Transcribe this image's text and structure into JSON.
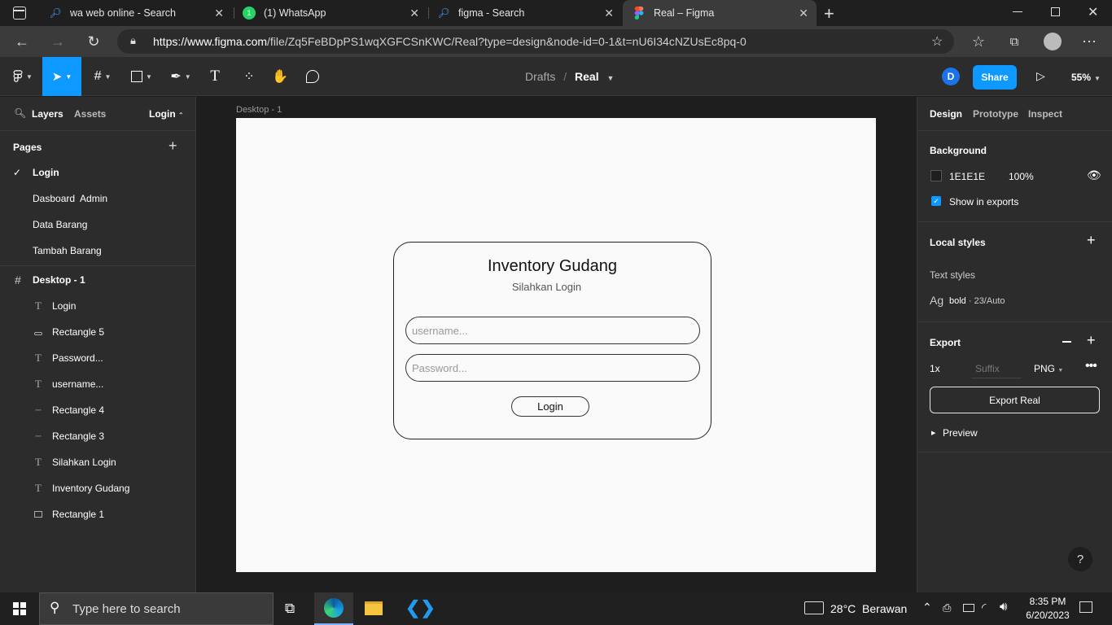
{
  "browser": {
    "tabs": [
      {
        "title": "wa web online - Search"
      },
      {
        "title": "(1) WhatsApp",
        "badge": "1"
      },
      {
        "title": "figma - Search"
      },
      {
        "title": "Real – Figma"
      }
    ],
    "url": "https://www.figma.com/file/Zq5FeBDpPS1wqXGFCSnKWC/Real?type=design&node-id=0-1&t=nU6I34cNZUsEc8pq-0",
    "url_host": "https://www.figma.com",
    "url_rest": "/file/Zq5FeBDpPS1wqXGFCSnKWC/Real?type=design&node-id=0-1&t=nU6I34cNZUsEc8pq-0"
  },
  "figma_toolbar": {
    "breadcrumb_drafts": "Drafts",
    "breadcrumb_sep": "/",
    "file_name": "Real",
    "avatar_letter": "D",
    "share_label": "Share",
    "zoom": "55%"
  },
  "left_panel": {
    "tabs": {
      "layers": "Layers",
      "assets": "Assets",
      "current_page": "Login"
    },
    "pages_title": "Pages",
    "pages": [
      {
        "label": "Login",
        "selected": true
      },
      {
        "label": "Dasboard  Admin"
      },
      {
        "label": "Data Barang"
      },
      {
        "label": "Tambah Barang"
      }
    ],
    "frame_name": "Desktop - 1",
    "layers": [
      {
        "label": "Login",
        "icon": "text-icon"
      },
      {
        "label": "Rectangle 5",
        "icon": "rectangle-icon"
      },
      {
        "label": "Password...",
        "icon": "text-icon"
      },
      {
        "label": "username...",
        "icon": "text-icon"
      },
      {
        "label": "Rectangle 4",
        "icon": "line-icon"
      },
      {
        "label": "Rectangle 3",
        "icon": "line-icon"
      },
      {
        "label": "Silahkan Login",
        "icon": "text-icon"
      },
      {
        "label": "Inventory Gudang",
        "icon": "text-icon"
      },
      {
        "label": "Rectangle 1",
        "icon": "rectangle-icon"
      }
    ]
  },
  "canvas": {
    "frame_label": "Desktop - 1",
    "card": {
      "title": "Inventory Gudang",
      "subtitle": "Silahkan Login",
      "username_placeholder": "username...",
      "password_placeholder": "Password...",
      "login_label": "Login"
    }
  },
  "right_panel": {
    "tabs": {
      "design": "Design",
      "prototype": "Prototype",
      "inspect": "Inspect"
    },
    "background_title": "Background",
    "bg_hex": "1E1E1E",
    "bg_opacity": "100%",
    "show_in_exports": "Show in exports",
    "local_styles_title": "Local styles",
    "text_styles_title": "Text styles",
    "text_style_sample": "Ag",
    "text_style_name": "bold",
    "text_style_meta": " · 23/Auto",
    "export_title": "Export",
    "export_scale": "1x",
    "export_suffix_placeholder": "Suffix",
    "export_format": "PNG",
    "export_button": "Export Real",
    "preview_label": "Preview",
    "help": "?"
  },
  "taskbar": {
    "search_placeholder": "Type here to search",
    "weather": "28°C  Berawan",
    "time": "8:35 PM",
    "date": "6/20/2023"
  },
  "colors": {
    "figma_blue": "#0d99ff",
    "panel_bg": "#2c2c2c",
    "canvas_bg": "#1e1e1e"
  }
}
